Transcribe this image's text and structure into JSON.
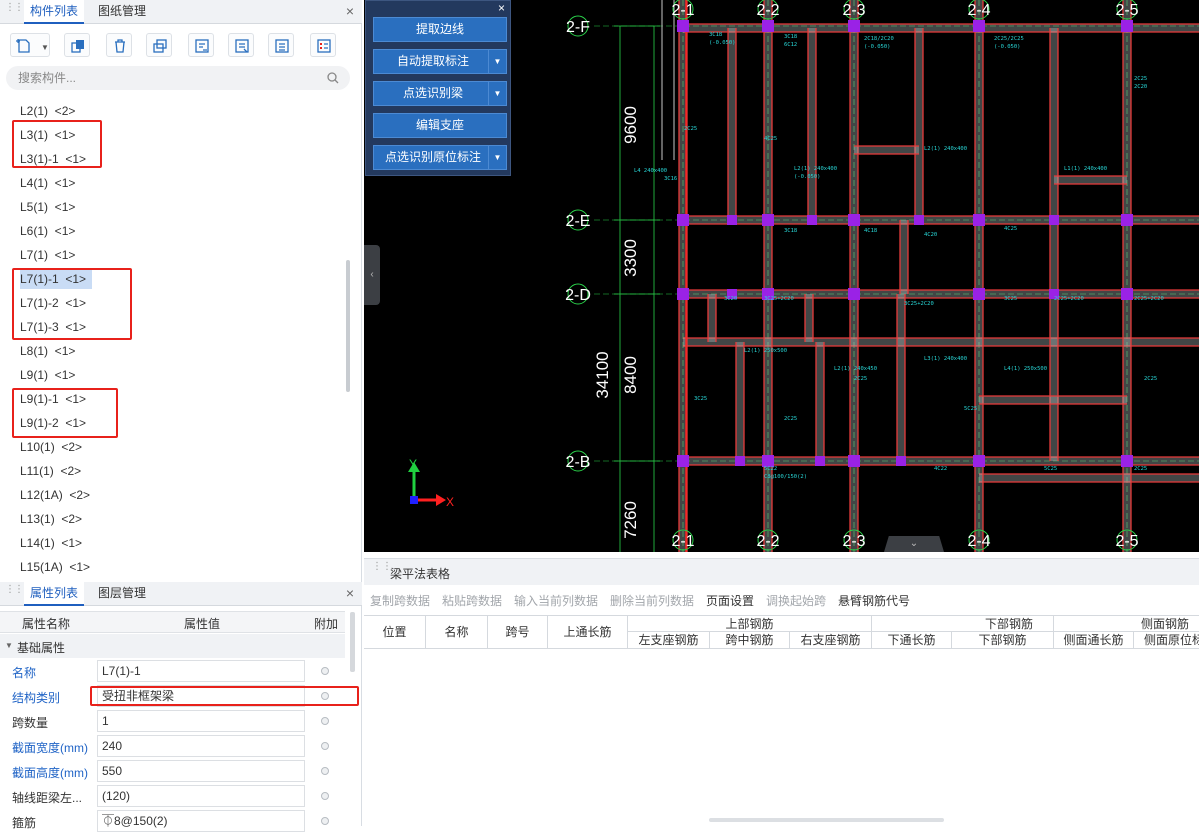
{
  "left_panel": {
    "top_tabs": [
      "构件列表",
      "图纸管理"
    ],
    "close": "×",
    "search_placeholder": "搜索构件...",
    "components": [
      "L2(1)  <2>",
      "L3(1)  <1>",
      "L3(1)-1  <1>",
      "L4(1)  <1>",
      "L5(1)  <1>",
      "L6(1)  <1>",
      "L7(1)  <1>",
      "L7(1)-1  <1>",
      "L7(1)-2  <1>",
      "L7(1)-3  <1>",
      "L8(1)  <1>",
      "L9(1)  <1>",
      "L9(1)-1  <1>",
      "L9(1)-2  <1>",
      "L10(1)  <2>",
      "L11(1)  <2>",
      "L12(1A)  <2>",
      "L13(1)  <2>",
      "L14(1)  <1>",
      "L15(1A)  <1>"
    ],
    "selected_component": "L7(1)-1  <1>",
    "bottom_tabs": [
      "属性列表",
      "图层管理"
    ],
    "grid_headers": {
      "name": "属性名称",
      "value": "属性值",
      "extra": "附加"
    },
    "section": "基础属性",
    "properties": [
      {
        "name": "名称",
        "value": "L7(1)-1",
        "blue": true
      },
      {
        "name": "结构类别",
        "value": "受扭非框架梁",
        "blue": true
      },
      {
        "name": "跨数量",
        "value": "1",
        "blue": false
      },
      {
        "name": "截面宽度(mm)",
        "value": "240",
        "blue": true
      },
      {
        "name": "截面高度(mm)",
        "value": "550",
        "blue": true
      },
      {
        "name": "轴线距梁左...",
        "value": "(120)",
        "blue": false
      },
      {
        "name": "箍筋",
        "value": "⏁8@150(2)",
        "blue": false
      }
    ]
  },
  "popup": {
    "close": "×",
    "buttons": [
      {
        "label": "提取边线",
        "dropdown": false
      },
      {
        "label": "自动提取标注",
        "dropdown": true
      },
      {
        "label": "点选识别梁",
        "dropdown": true
      },
      {
        "label": "编辑支座",
        "dropdown": false
      },
      {
        "label": "点选识别原位标注",
        "dropdown": true
      }
    ]
  },
  "cad": {
    "axis_top": [
      "2-1",
      "2-2",
      "2-3",
      "2-4",
      "2-5"
    ],
    "axis_bottom": [
      "2-1",
      "2-2",
      "2-3",
      "2-4",
      "2-5"
    ],
    "axis_left": [
      "2-F",
      "2-E",
      "2-D",
      "2-B"
    ],
    "dims": [
      "9600",
      "3300",
      "34100",
      "8400",
      "7260"
    ],
    "ucs_y": "Y",
    "ucs_x": "X",
    "colors": {
      "background": "#000000",
      "beam": "#e83a3a",
      "beam_inner": "#b9c9c9",
      "column": "#9a22e6",
      "axis": "#2ad24a",
      "text": "#28d8d8"
    }
  },
  "table_panel": {
    "title": "梁平法表格",
    "toolbar": [
      {
        "label": "复制跨数据",
        "enabled": false
      },
      {
        "label": "粘贴跨数据",
        "enabled": false
      },
      {
        "label": "输入当前列数据",
        "enabled": false
      },
      {
        "label": "删除当前列数据",
        "enabled": false
      },
      {
        "label": "页面设置",
        "enabled": true
      },
      {
        "label": "调换起始跨",
        "enabled": false
      },
      {
        "label": "悬臂钢筋代号",
        "enabled": true
      }
    ],
    "columns": {
      "position": "位置",
      "name": "名称",
      "span": "跨号",
      "top_long": "上通长筋",
      "top_group": "上部钢筋",
      "top_sub": [
        "左支座钢筋",
        "跨中钢筋",
        "右支座钢筋"
      ],
      "bottom_group": "下部钢筋",
      "bottom_sub": [
        "下通长筋",
        "下部钢筋"
      ],
      "side_group": "侧面钢筋",
      "side_sub": [
        "侧面通长筋",
        "侧面原位标"
      ]
    }
  }
}
